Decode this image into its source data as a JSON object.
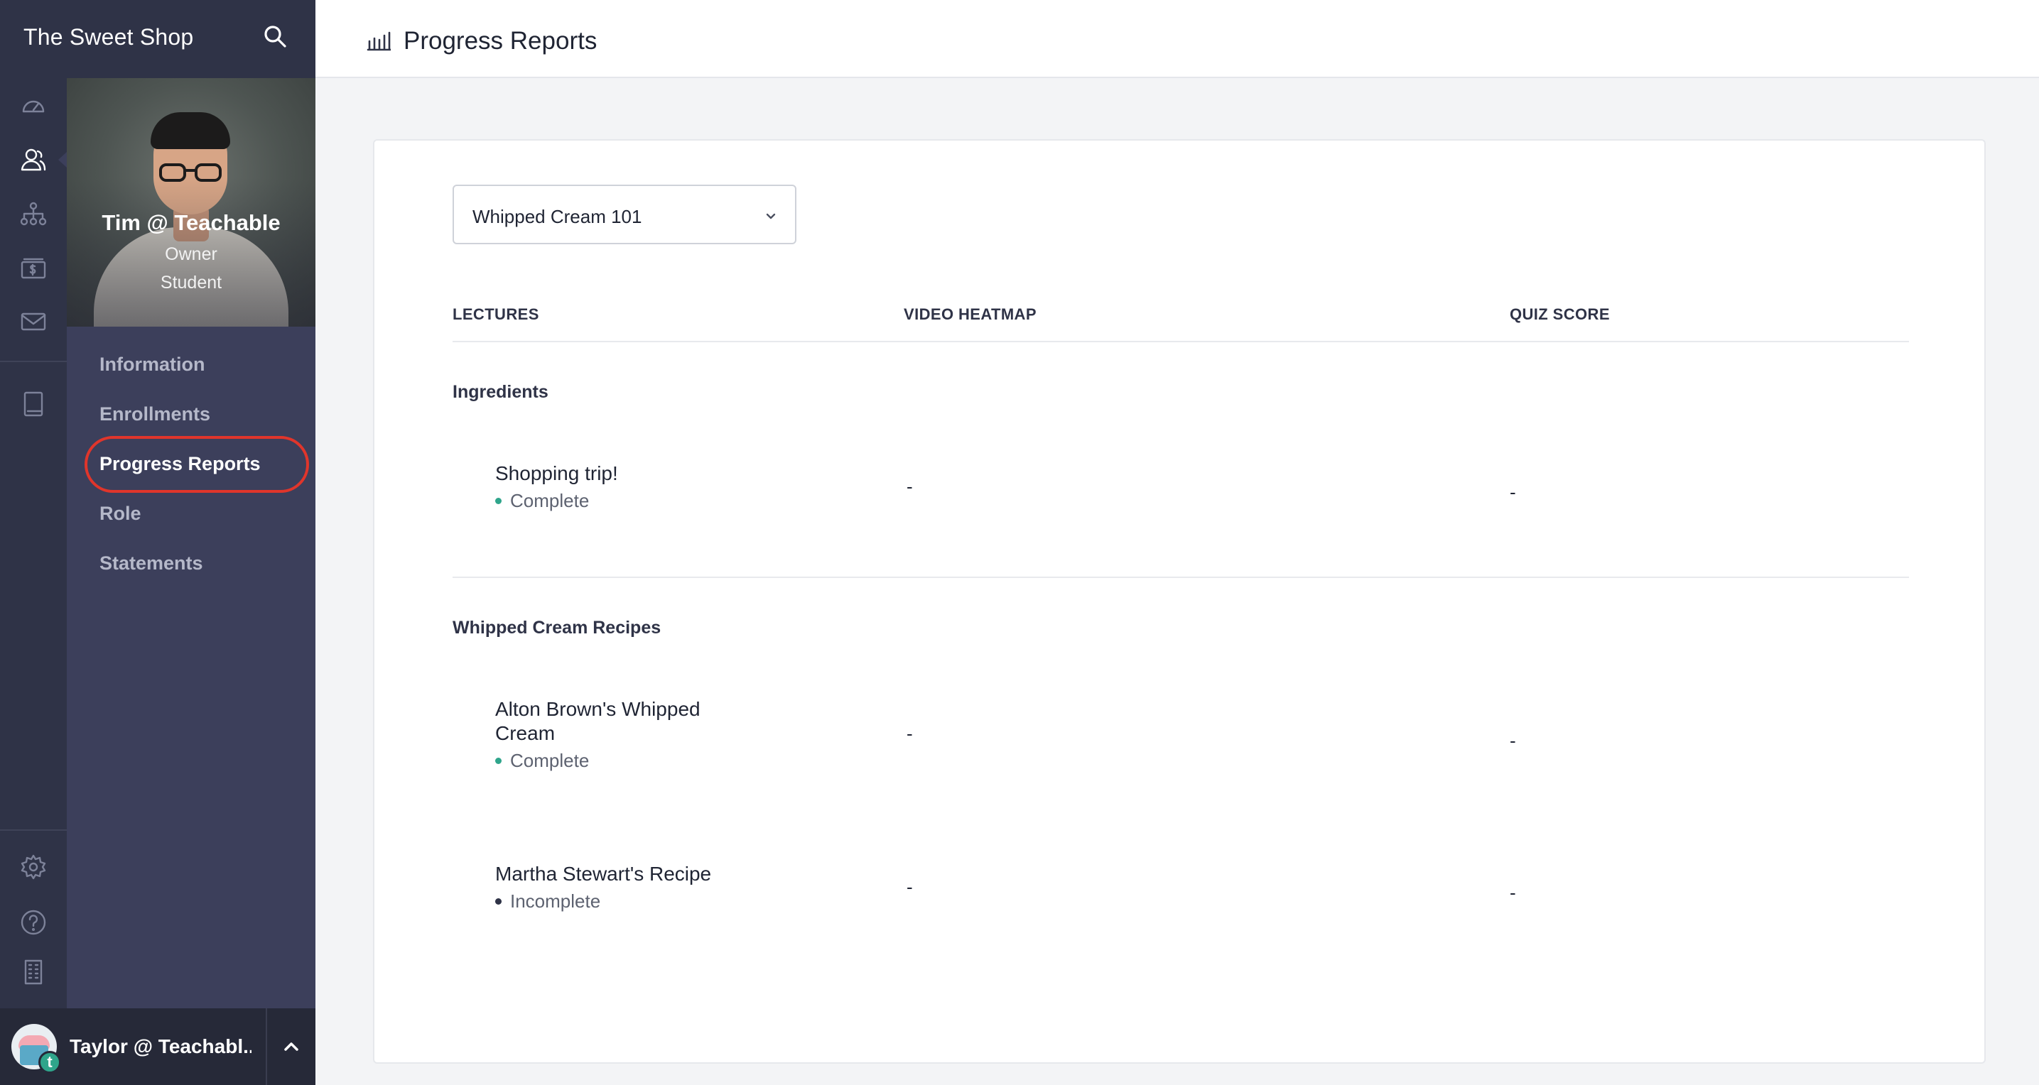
{
  "brand": {
    "title": "The Sweet Shop"
  },
  "rail": {
    "icons": [
      "speedometer-icon",
      "users-icon",
      "sitemap-icon",
      "sales-icon",
      "mail-icon",
      "book-icon",
      "gear-icon",
      "help-icon",
      "building-icon"
    ],
    "active": "users-icon"
  },
  "profile": {
    "name": "Tim @ Teachable",
    "roles": [
      "Owner",
      "Student"
    ]
  },
  "nav": {
    "items": [
      {
        "label": "Information"
      },
      {
        "label": "Enrollments"
      },
      {
        "label": "Progress Reports"
      },
      {
        "label": "Role"
      },
      {
        "label": "Statements"
      }
    ],
    "active": "Progress Reports",
    "highlight_color": "#e0352b"
  },
  "user": {
    "name": "Taylor @ Teachabl...",
    "badge": "t"
  },
  "header": {
    "title": "Progress Reports",
    "icon": "bar-chart-icon"
  },
  "course_select": {
    "value": "Whipped Cream 101"
  },
  "table": {
    "columns": [
      "LECTURES",
      "VIDEO HEATMAP",
      "QUIZ SCORE"
    ],
    "sections": [
      {
        "title": "Ingredients",
        "lectures": [
          {
            "title": "Shopping trip!",
            "status": "Complete",
            "video_heatmap": "-",
            "quiz_score": "-"
          }
        ]
      },
      {
        "title": "Whipped Cream Recipes",
        "lectures": [
          {
            "title": "Alton Brown's Whipped Cream",
            "status": "Complete",
            "video_heatmap": "-",
            "quiz_score": "-"
          },
          {
            "title": "Martha Stewart's Recipe",
            "status": "Incomplete",
            "video_heatmap": "-",
            "quiz_score": "-"
          }
        ]
      }
    ]
  },
  "colors": {
    "sidebar": "#2f3347",
    "panel": "#3c3f5b",
    "complete": "#2fa58b",
    "accent_ring": "#e0352b"
  }
}
